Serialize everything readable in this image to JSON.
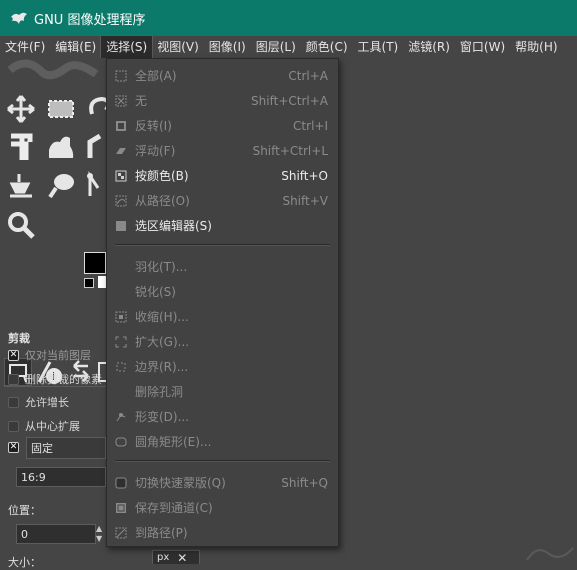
{
  "window": {
    "title": "GNU 图像处理程序"
  },
  "menubar": [
    "文件(F)",
    "编辑(E)",
    "选择(S)",
    "视图(V)",
    "图像(I)",
    "图层(L)",
    "颜色(C)",
    "工具(T)",
    "滤镜(R)",
    "窗口(W)",
    "帮助(H)"
  ],
  "select_menu": {
    "items": [
      {
        "label": "全部(A)",
        "accel": "Ctrl+A",
        "icon": "select-all-icon",
        "enabled": false
      },
      {
        "label": "无",
        "accel": "Shift+Ctrl+A",
        "icon": "select-none-icon",
        "enabled": false
      },
      {
        "label": "反转(I)",
        "accel": "Ctrl+I",
        "icon": "invert-icon",
        "enabled": false
      },
      {
        "label": "浮动(F)",
        "accel": "Shift+Ctrl+L",
        "icon": "float-icon",
        "enabled": false
      },
      {
        "label": "按颜色(B)",
        "accel": "Shift+O",
        "icon": "by-color-icon",
        "enabled": true
      },
      {
        "label": "从路径(O)",
        "accel": "Shift+V",
        "icon": "from-path-icon",
        "enabled": false
      },
      {
        "label": "选区编辑器(S)",
        "accel": "",
        "icon": "selection-editor-icon",
        "enabled": true
      },
      {
        "label": "羽化(T)...",
        "accel": "",
        "icon": "",
        "enabled": false
      },
      {
        "label": "锐化(S)",
        "accel": "",
        "icon": "",
        "enabled": false
      },
      {
        "label": "收缩(H)...",
        "accel": "",
        "icon": "shrink-icon",
        "enabled": false
      },
      {
        "label": "扩大(G)...",
        "accel": "",
        "icon": "grow-icon",
        "enabled": false
      },
      {
        "label": "边界(R)...",
        "accel": "",
        "icon": "border-icon",
        "enabled": false
      },
      {
        "label": "删除孔洞",
        "accel": "",
        "icon": "",
        "enabled": false
      },
      {
        "label": "形变(D)...",
        "accel": "",
        "icon": "distort-icon",
        "enabled": false
      },
      {
        "label": "圆角矩形(E)...",
        "accel": "",
        "icon": "rounded-rect-icon",
        "enabled": false
      },
      {
        "label": "切换快速蒙版(Q)",
        "accel": "Shift+Q",
        "icon": "quick-mask-icon",
        "enabled": false
      },
      {
        "label": "保存到通道(C)",
        "accel": "",
        "icon": "save-channel-icon",
        "enabled": false
      },
      {
        "label": "到路径(P)",
        "accel": "",
        "icon": "to-path-icon",
        "enabled": false
      }
    ]
  },
  "tool_options": {
    "title": "剪裁",
    "current_layer_only": "仅对当前图层",
    "delete_cropped": "删除剪裁的像素",
    "allow_growing": "允许增长",
    "expand_from_center": "从中心扩展",
    "fixed_label": "固定",
    "aspect_value": "16:9",
    "position_label": "位置：",
    "position_value": "0",
    "size_label": "大小：",
    "unit": "px"
  },
  "colors": {
    "titlebar": "#0b7a6a",
    "bg": "#454545",
    "menu_bg": "#424242"
  }
}
